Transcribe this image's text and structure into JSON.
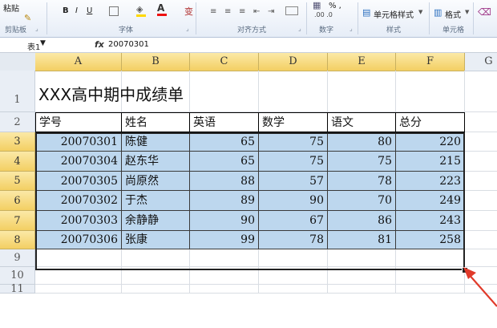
{
  "ribbon": {
    "paste_label": "粘贴",
    "groups": {
      "clipboard": "剪贴板",
      "font": "字体",
      "alignment": "对齐方式",
      "number": "数字",
      "styles": "样式",
      "cells": "单元格"
    },
    "font_buttons": {
      "bold": "B",
      "italic": "I",
      "underline": "U"
    },
    "number_format": "% ,",
    "cell_styles_label": "单元格样式",
    "format_label": "格式"
  },
  "formula_bar": {
    "name_box": "表1",
    "fx_label": "fx",
    "value": "20070301"
  },
  "columns": [
    "A",
    "B",
    "C",
    "D",
    "E",
    "F",
    "G"
  ],
  "rows": [
    "1",
    "2",
    "3",
    "4",
    "5",
    "6",
    "7",
    "8",
    "9",
    "10",
    "11"
  ],
  "sheet": {
    "title": "XXX高中期中成绩单",
    "headers": [
      "学号",
      "姓名",
      "英语",
      "数学",
      "语文",
      "总分"
    ],
    "records": [
      [
        "20070301",
        "陈健",
        "65",
        "75",
        "80",
        "220"
      ],
      [
        "20070304",
        "赵东华",
        "65",
        "75",
        "75",
        "215"
      ],
      [
        "20070305",
        "尚原然",
        "88",
        "57",
        "78",
        "223"
      ],
      [
        "20070302",
        "于杰",
        "89",
        "90",
        "70",
        "249"
      ],
      [
        "20070303",
        "余静静",
        "90",
        "67",
        "86",
        "243"
      ],
      [
        "20070306",
        "张康",
        "99",
        "78",
        "81",
        "258"
      ]
    ]
  },
  "colors": {
    "selection": "#bdd7ee",
    "header_gold": "#f3cf63",
    "arrow": "#e03a2a"
  }
}
